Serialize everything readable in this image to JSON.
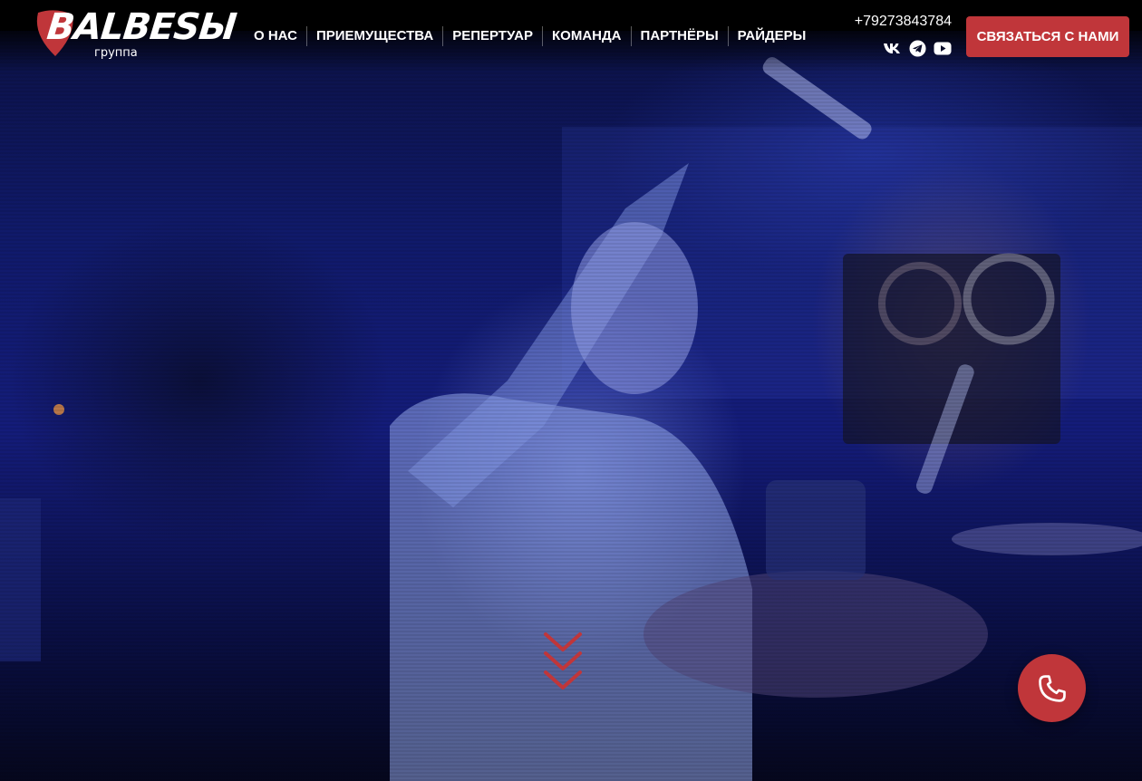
{
  "brand": {
    "logo_text": "BALBESЫ",
    "logo_subtitle": "группа",
    "accent_color": "#c0363a"
  },
  "nav": {
    "items": [
      {
        "label": "О НАС"
      },
      {
        "label": "ПРИЕМУЩЕСТВА"
      },
      {
        "label": "РЕПЕРТУАР"
      },
      {
        "label": "КОМАНДА"
      },
      {
        "label": "ПАРТНЁРЫ"
      },
      {
        "label": "РАЙДЕРЫ"
      }
    ]
  },
  "contacts": {
    "phone": "+79273843784",
    "socials": [
      {
        "icon": "vk-icon"
      },
      {
        "icon": "telegram-icon"
      },
      {
        "icon": "youtube-icon"
      }
    ]
  },
  "cta": {
    "label": "СВЯЗАТЬСЯ С НАМИ"
  },
  "hero": {
    "media": "video-background",
    "scroll_icon": "chevrons-down-icon"
  },
  "floating": {
    "icon": "phone-icon"
  }
}
